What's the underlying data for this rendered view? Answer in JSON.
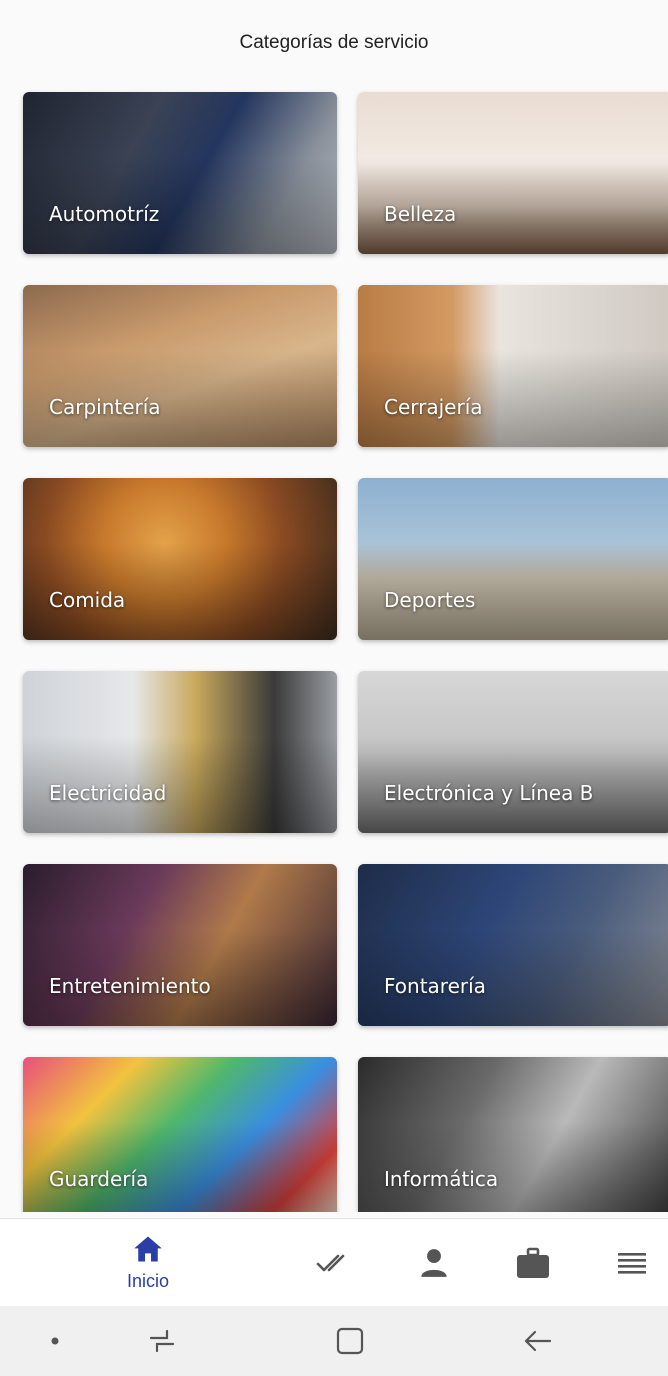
{
  "header": {
    "title": "Categorías de servicio"
  },
  "categories": [
    {
      "label": "Automotríz",
      "image": "automotive-photo"
    },
    {
      "label": "Belleza",
      "image": "beauty-spa-photo"
    },
    {
      "label": "Carpintería",
      "image": "carpentry-photo"
    },
    {
      "label": "Cerrajería",
      "image": "locksmith-photo"
    },
    {
      "label": "Comida",
      "image": "pizza-photo"
    },
    {
      "label": "Deportes",
      "image": "runners-photo"
    },
    {
      "label": "Electricidad",
      "image": "electrician-photo"
    },
    {
      "label": "Electrónica y Línea B",
      "image": "appliances-photo"
    },
    {
      "label": "Entretenimiento",
      "image": "party-photo"
    },
    {
      "label": "Fontarería",
      "image": "plumber-photo"
    },
    {
      "label": "Guardería",
      "image": "kids-blocks-photo"
    },
    {
      "label": "Informática",
      "image": "laptop-photo"
    }
  ],
  "bottom_nav": {
    "active_color": "#2a3ea6",
    "inactive_color": "#555555",
    "items": [
      {
        "label": "Inicio",
        "icon": "home-icon",
        "active": true
      },
      {
        "icon": "double-check-icon"
      },
      {
        "icon": "person-icon"
      },
      {
        "icon": "briefcase-icon"
      },
      {
        "icon": "menu-icon"
      }
    ]
  },
  "system_nav": {
    "items": [
      {
        "icon": "dot-icon"
      },
      {
        "icon": "recent-apps-icon"
      },
      {
        "icon": "home-square-icon"
      },
      {
        "icon": "back-arrow-icon"
      }
    ]
  }
}
